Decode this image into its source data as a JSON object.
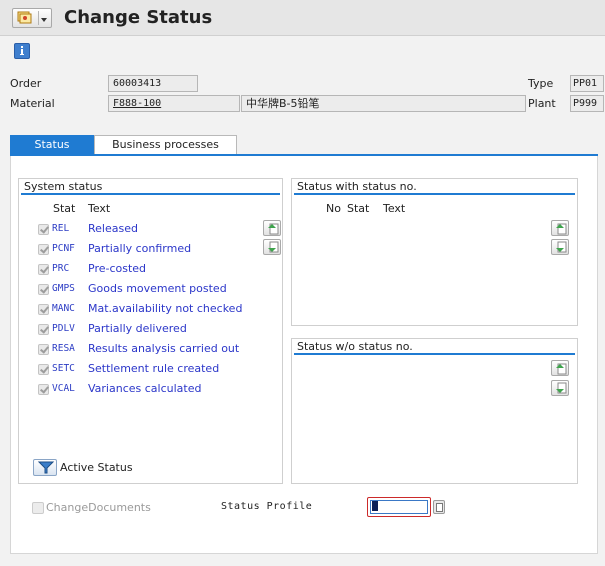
{
  "window": {
    "title": "Change Status"
  },
  "header": {
    "order_label": "Order",
    "order_value": "60003413",
    "material_label": "Material",
    "material_value": "F888-100",
    "material_desc": "中华牌B-5铅笔",
    "type_label": "Type",
    "type_value": "PP01",
    "plant_label": "Plant",
    "plant_value": "P999"
  },
  "tabs": [
    {
      "label": "Status",
      "active": true
    },
    {
      "label": "Business processes",
      "active": false
    }
  ],
  "system_status": {
    "title": "System status",
    "col_stat": "Stat",
    "col_text": "Text",
    "rows": [
      {
        "stat": "REL",
        "text": "Released"
      },
      {
        "stat": "PCNF",
        "text": "Partially confirmed"
      },
      {
        "stat": "PRC",
        "text": "Pre-costed"
      },
      {
        "stat": "GMPS",
        "text": "Goods movement posted"
      },
      {
        "stat": "MANC",
        "text": "Mat.availability not checked"
      },
      {
        "stat": "PDLV",
        "text": "Partially delivered"
      },
      {
        "stat": "RESA",
        "text": "Results analysis carried out"
      },
      {
        "stat": "SETC",
        "text": "Settlement rule created"
      },
      {
        "stat": "VCAL",
        "text": "Variances calculated"
      }
    ],
    "active_status_label": "Active Status"
  },
  "status_with_no": {
    "title": "Status with status no.",
    "col_no": "No",
    "col_stat": "Stat",
    "col_text": "Text"
  },
  "status_without_no": {
    "title": "Status w/o status no."
  },
  "footer": {
    "change_documents_label": "ChangeDocuments",
    "status_profile_label": "Status Profile",
    "status_profile_value": ""
  },
  "colors": {
    "accent": "#1f7bd2",
    "status_text": "#2b36c9",
    "required_border": "#cc2a2a"
  },
  "icons": [
    "menu-icon",
    "info-icon",
    "scroll-up-icon",
    "scroll-down-icon",
    "filter-icon",
    "value-help-icon"
  ]
}
